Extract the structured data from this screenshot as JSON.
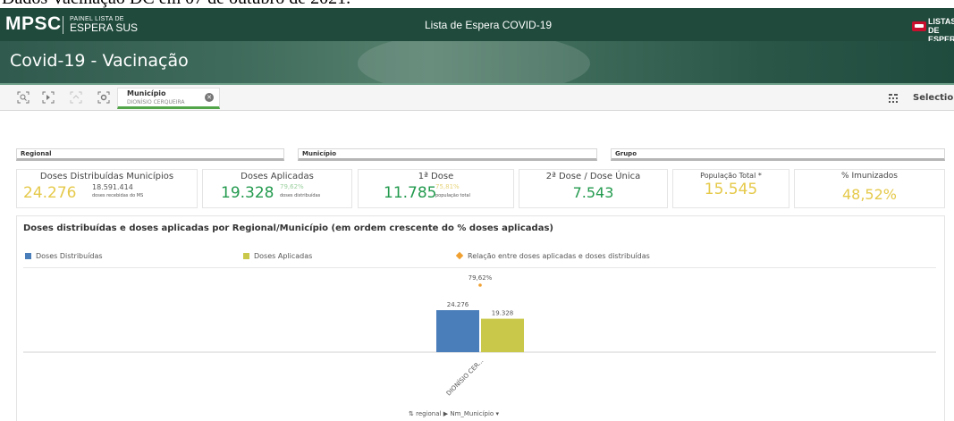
{
  "caption": "Dados Vacinação DC em 07 de outubro de 2021.",
  "header": {
    "logo": "MPSC",
    "panel_line1": "PAINEL LISTA DE",
    "panel_line2": "ESPERA SUS",
    "title": "Lista de Espera   COVID-19",
    "brand_line1": "LISTAS DE",
    "brand_line2": "ESPERA"
  },
  "banner": {
    "title": "Covid-19 - Vacinação"
  },
  "selections_bar": {
    "tools": [
      "smart-search-icon",
      "selections-tool-icon",
      "step-back-icon",
      "clear-selections-icon"
    ],
    "chip_field": "Município",
    "chip_value": "DIONÍSIO CERQUEIRA",
    "selections_label": "Selections"
  },
  "filters": [
    "Regional",
    "Município",
    "Grupo"
  ],
  "kpis": [
    {
      "label": "Doses Distribuídas Municípios",
      "value": "24.276",
      "sub_value": "18.591.414",
      "sub_label": "doses recebidas do MS",
      "color": "#e5c94a"
    },
    {
      "label": "Doses Aplicadas",
      "value": "19.328",
      "sub_value": "79,62%",
      "sub_label": "doses distribuídas",
      "color": "#239a4e"
    },
    {
      "label": "1ª Dose",
      "value": "11.785",
      "sub_value": "75,81%",
      "sub_label": "população total",
      "color": "#239a4e"
    },
    {
      "label": "2ª Dose / Dose Única",
      "value": "7.543",
      "color": "#239a4e"
    },
    {
      "label": "População Total *",
      "value": "15.545",
      "color": "#e5c94a"
    },
    {
      "label": "% Imunizados",
      "value": "48,52%",
      "color": "#e5c94a"
    }
  ],
  "colors": {
    "distribuidas": "#4a7ebb",
    "aplicadas": "#c9c84a",
    "relacao": "#f0a030",
    "green": "#239a4e",
    "yellow": "#e5c94a"
  },
  "chart_data": {
    "type": "bar",
    "title": "Doses distribuídas e doses aplicadas por Regional/Município (em ordem crescente do % doses aplicadas)",
    "categories": [
      "DIONÍSIO CER..."
    ],
    "series": [
      {
        "name": "Doses Distribuídas",
        "values": [
          24276
        ],
        "labels": [
          "24.276"
        ]
      },
      {
        "name": "Doses Aplicadas",
        "values": [
          19328
        ],
        "labels": [
          "19.328"
        ]
      }
    ],
    "line_series": {
      "name": "Relação entre doses aplicadas e doses distribuídas",
      "values": [
        79.62
      ],
      "labels": [
        "79,62%"
      ]
    },
    "ylim": [
      0,
      24276
    ],
    "dimension_bar": {
      "left": "regional",
      "right": "Nm_Município"
    }
  }
}
